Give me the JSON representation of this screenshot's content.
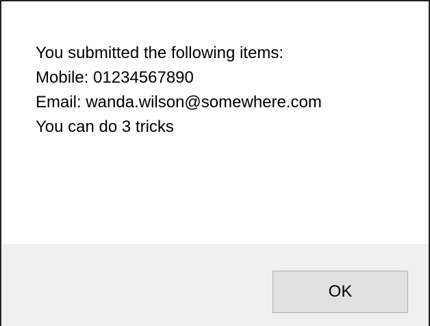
{
  "dialog": {
    "lines": [
      "You submitted the following items:",
      "Mobile: 01234567890",
      "Email: wanda.wilson@somewhere.com",
      "You can do 3 tricks"
    ],
    "ok_label": "OK"
  },
  "colors": {
    "background": "#ffffff",
    "button_bar": "#f0f0f0",
    "button_face": "#e1e1e1",
    "button_border": "#adadad",
    "border": "#222222"
  }
}
